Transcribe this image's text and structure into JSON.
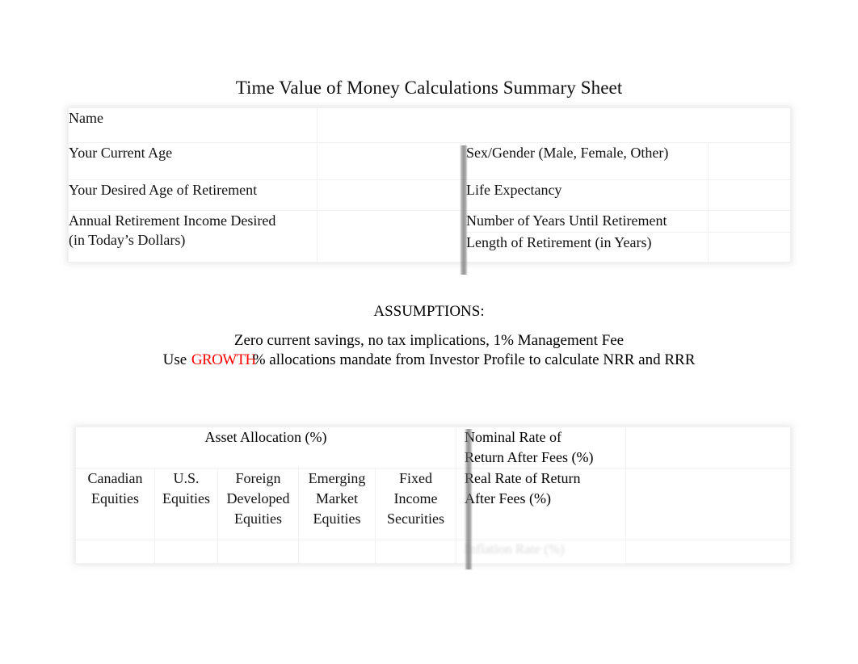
{
  "document": {
    "title": "Time Value of Money Calculations Summary Sheet"
  },
  "personal_table": {
    "rows": [
      {
        "left_label": "Name",
        "right_label": ""
      },
      {
        "left_label": "Your Current Age",
        "right_label": "Sex/Gender (Male, Female, Other)"
      },
      {
        "left_label": "Your Desired Age of Retirement",
        "right_label": "Life Expectancy"
      },
      {
        "left_label": "Annual Retirement Income Desired\n(in Today’s Dollars)",
        "right_label": "Number of Years Until Retirement"
      },
      {
        "left_label": "",
        "right_label": "Length of Retirement (in Years)"
      }
    ]
  },
  "assumptions": {
    "heading": "ASSUMPTIONS:",
    "line1": "Zero current savings, no tax implications, 1% Management Fee",
    "line2_prefix": "Use ",
    "line2_highlight": "GROWTH",
    "line2_suffix": "% allocations mandate from Investor Profile to calculate NRR and RRR",
    "highlight_color": "#ff0000"
  },
  "allocation_table": {
    "group_title": "Asset Allocation (%)",
    "columns": [
      "Canadian\nEquities",
      "U.S.\nEquities",
      "Foreign\nDeveloped\nEquities",
      "Emerging\nMarket\nEquities",
      "Fixed\nIncome\nSecurities"
    ],
    "rate_rows": [
      "Nominal Rate of\nReturn After Fees (%)",
      "Real Rate of Return\nAfter Fees (%)"
    ],
    "faint_row_label": "Inflation Rate (%)"
  }
}
